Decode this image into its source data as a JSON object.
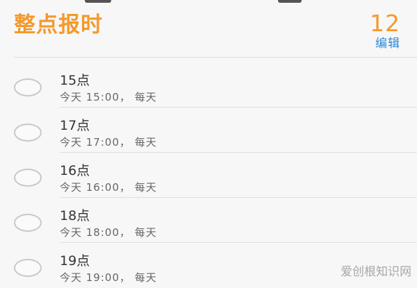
{
  "header": {
    "title": "整点报时",
    "count": "12",
    "edit_label": "编辑"
  },
  "items": [
    {
      "title": "15点",
      "subtitle": "今天 15:00， 每天"
    },
    {
      "title": "17点",
      "subtitle": "今天 17:00， 每天"
    },
    {
      "title": "16点",
      "subtitle": "今天 16:00， 每天"
    },
    {
      "title": "18点",
      "subtitle": "今天 18:00， 每天"
    },
    {
      "title": "19点",
      "subtitle": "今天 19:00， 每天"
    }
  ],
  "watermark": "爱创根知识网",
  "colors": {
    "accent_orange": "#f5992b",
    "link_blue": "#2f8ad8",
    "background": "#f7f7f7"
  }
}
